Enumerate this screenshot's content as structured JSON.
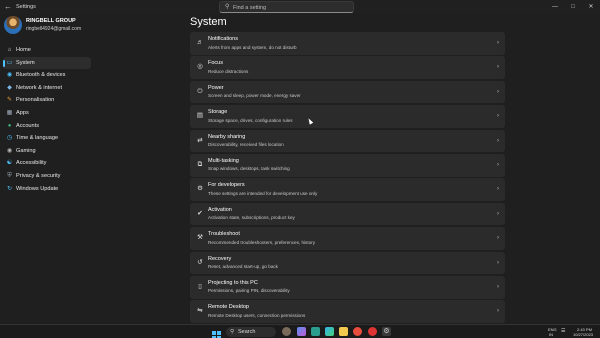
{
  "titlebar": {
    "app_title": "Settings",
    "search_placeholder": "Find a setting"
  },
  "profile": {
    "name": "RINGBELL GROUP",
    "email": "ringbell4924@gmail.com"
  },
  "sidebar": {
    "items": [
      {
        "label": "Home",
        "icon": "home-icon",
        "active": false
      },
      {
        "label": "System",
        "icon": "system-icon",
        "active": true
      },
      {
        "label": "Bluetooth & devices",
        "icon": "bluetooth-icon",
        "active": false
      },
      {
        "label": "Network & internet",
        "icon": "network-icon",
        "active": false
      },
      {
        "label": "Personalisation",
        "icon": "brush-icon",
        "active": false
      },
      {
        "label": "Apps",
        "icon": "apps-icon",
        "active": false
      },
      {
        "label": "Accounts",
        "icon": "accounts-icon",
        "active": false
      },
      {
        "label": "Time & language",
        "icon": "clock-icon",
        "active": false
      },
      {
        "label": "Gaming",
        "icon": "gamepad-icon",
        "active": false
      },
      {
        "label": "Accessibility",
        "icon": "accessibility-icon",
        "active": false
      },
      {
        "label": "Privacy & security",
        "icon": "shield-icon",
        "active": false
      },
      {
        "label": "Windows Update",
        "icon": "update-icon",
        "active": false
      }
    ]
  },
  "main": {
    "page_title": "System",
    "rows": [
      {
        "title": "Notifications",
        "subtitle": "Alerts from apps and system, do not disturb",
        "icon": "bell-icon"
      },
      {
        "title": "Focus",
        "subtitle": "Reduce distractions",
        "icon": "focus-icon"
      },
      {
        "title": "Power",
        "subtitle": "Screen and sleep, power mode, energy saver",
        "icon": "power-icon"
      },
      {
        "title": "Storage",
        "subtitle": "Storage space, drives, configuration rules",
        "icon": "storage-icon"
      },
      {
        "title": "Nearby sharing",
        "subtitle": "Discoverability, received files location",
        "icon": "share-icon"
      },
      {
        "title": "Multi-tasking",
        "subtitle": "Snap windows, desktops, task switching",
        "icon": "multitask-icon"
      },
      {
        "title": "For developers",
        "subtitle": "These settings are intended for development use only",
        "icon": "developer-icon"
      },
      {
        "title": "Activation",
        "subtitle": "Activation state, subscriptions, product key",
        "icon": "activation-icon"
      },
      {
        "title": "Troubleshoot",
        "subtitle": "Recommended troubleshooters, preferences, history",
        "icon": "wrench-icon"
      },
      {
        "title": "Recovery",
        "subtitle": "Reset, advanced start-up, go back",
        "icon": "recovery-icon"
      },
      {
        "title": "Projecting to this PC",
        "subtitle": "Permissions, pairing PIN, discoverability",
        "icon": "projector-icon"
      },
      {
        "title": "Remote Desktop",
        "subtitle": "Remote Desktop users, connection permissions",
        "icon": "remote-desktop-icon"
      }
    ]
  },
  "taskbar": {
    "search_label": "Search",
    "lang_top": "ENG",
    "lang_bottom": "IN",
    "time": "2:43 PM",
    "date": "10/27/2023"
  },
  "colors": {
    "accent": "#4cc2ff",
    "background": "#1f1f1f",
    "card": "#2b2b2b"
  }
}
